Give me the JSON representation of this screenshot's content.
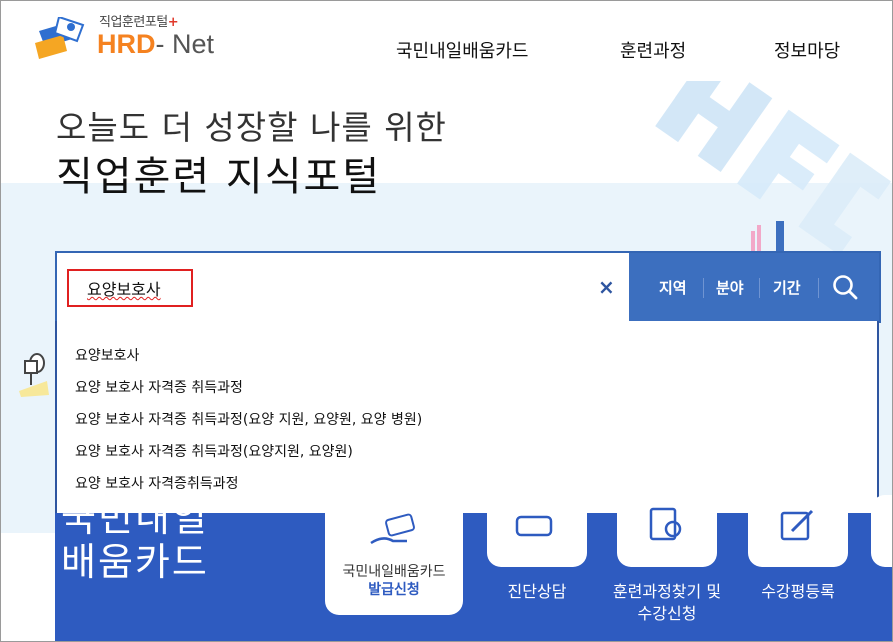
{
  "header": {
    "logo_small": "직업훈련포털",
    "logo_plus": "+",
    "logo_hrd": "HRD",
    "logo_net": "- Net",
    "nav": [
      "국민내일배움카드",
      "훈련과정",
      "정보마당"
    ]
  },
  "hero": {
    "line1": "오늘도 더 성장할 나를 위한",
    "line2": "직업훈련 지식포털"
  },
  "search": {
    "value": "요양보호사",
    "clear_label": "×",
    "filters": [
      "지역",
      "분야",
      "기간"
    ]
  },
  "suggestions": [
    "요양보호사",
    "요양 보호사 자격증 취득과정",
    "요양 보호사 자격증 취득과정(요양 지원, 요양원, 요양 병원)",
    "요양 보호사 자격증 취득과정(요양지원, 요양원)",
    "요양 보호사 자격증취득과정"
  ],
  "bottom": {
    "card_title_1": "국민내일",
    "card_title_2": "배움카드",
    "card1_line1": "국민내일배움카드",
    "card1_line2": "발급신청",
    "services": [
      "진단상담",
      "훈련과정찾기 및",
      "수강신청",
      "수강평등록"
    ]
  },
  "colors": {
    "primary_blue": "#2e5bc0",
    "filter_blue": "#3c6fbf",
    "logo_orange": "#f58220",
    "highlight_red": "#e02020"
  }
}
